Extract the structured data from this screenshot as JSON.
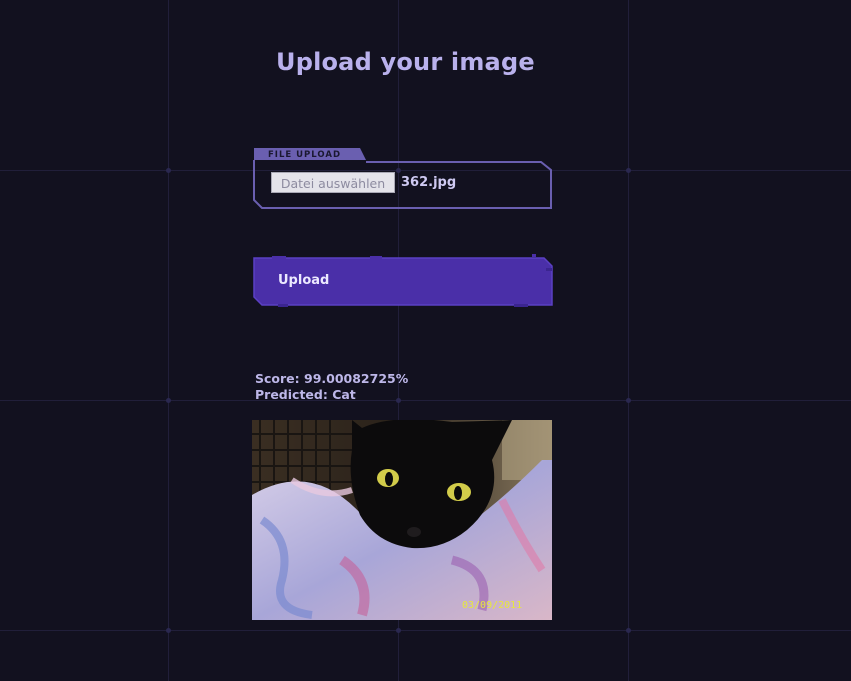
{
  "page": {
    "title": "Upload your image"
  },
  "file_upload": {
    "label": "FILE UPLOAD",
    "choose_button": "Datei auswählen",
    "selected_file": "362.jpg"
  },
  "upload_button": {
    "label": "Upload"
  },
  "result": {
    "score": "Score: 99.00082725%",
    "predicted": "Predicted: Cat"
  },
  "photo": {
    "subject": "black cat wrapped in a floral blanket",
    "date_stamp": "03/09/2011"
  },
  "colors": {
    "background": "#12111f",
    "accent": "#4a2fa8",
    "frame": "#6a5fb0",
    "text": "#bdb7e8"
  }
}
